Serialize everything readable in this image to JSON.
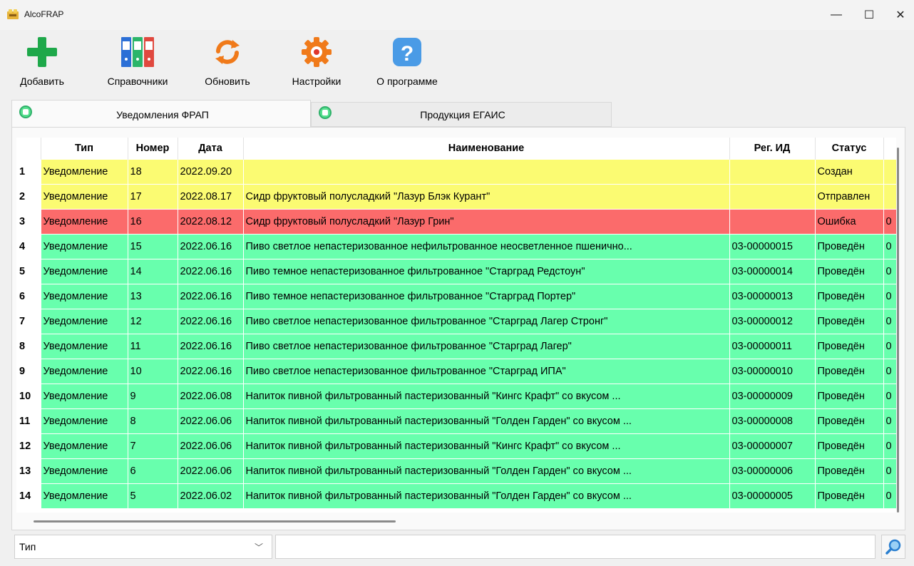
{
  "window": {
    "title": "AlcoFRAP",
    "minimize": "—",
    "maximize": "☐",
    "close": "✕"
  },
  "toolbar": {
    "add_label": "Добавить",
    "refs_label": "Справочники",
    "refresh_label": "Обновить",
    "settings_label": "Настройки",
    "about_label": "О программе"
  },
  "tabs": [
    {
      "label": "Уведомления ФРАП",
      "active": true
    },
    {
      "label": "Продукция ЕГАИС",
      "active": false
    }
  ],
  "table": {
    "columns": [
      "Тип",
      "Номер",
      "Дата",
      "Наименование",
      "Рег. ИД",
      "Статус"
    ],
    "rows": [
      {
        "n": "1",
        "type": "Уведомление",
        "num": "18",
        "date": "2022.09.20",
        "name": "",
        "reg": "",
        "status": "Создан",
        "extra": "",
        "state": "created"
      },
      {
        "n": "2",
        "type": "Уведомление",
        "num": "17",
        "date": "2022.08.17",
        "name": "Сидр фруктовый полусладкий \"Лазур Блэк Курант\"",
        "reg": "",
        "status": "Отправлен",
        "extra": "",
        "state": "sent"
      },
      {
        "n": "3",
        "type": "Уведомление",
        "num": "16",
        "date": "2022.08.12",
        "name": "Сидр фруктовый полусладкий \"Лазур Грин\"",
        "reg": "",
        "status": "Ошибка",
        "extra": "0",
        "state": "error"
      },
      {
        "n": "4",
        "type": "Уведомление",
        "num": "15",
        "date": "2022.06.16",
        "name": "Пиво светлое непастеризованное нефильтрованное неосветленное пшенично...",
        "reg": "03-00000015",
        "status": "Проведён",
        "extra": "0",
        "state": "done"
      },
      {
        "n": "5",
        "type": "Уведомление",
        "num": "14",
        "date": "2022.06.16",
        "name": "Пиво темное непастеризованное фильтрованное \"Старград Редстоун\"",
        "reg": "03-00000014",
        "status": "Проведён",
        "extra": "0",
        "state": "done"
      },
      {
        "n": "6",
        "type": "Уведомление",
        "num": "13",
        "date": "2022.06.16",
        "name": "Пиво темное непастеризованное фильтрованное \"Старград Портер\"",
        "reg": "03-00000013",
        "status": "Проведён",
        "extra": "0",
        "state": "done"
      },
      {
        "n": "7",
        "type": "Уведомление",
        "num": "12",
        "date": "2022.06.16",
        "name": "Пиво светлое непастеризованное фильтрованное \"Старград Лагер Стронг\"",
        "reg": "03-00000012",
        "status": "Проведён",
        "extra": "0",
        "state": "done"
      },
      {
        "n": "8",
        "type": "Уведомление",
        "num": "11",
        "date": "2022.06.16",
        "name": "Пиво светлое непастеризованное фильтрованное \"Старград Лагер\"",
        "reg": "03-00000011",
        "status": "Проведён",
        "extra": "0",
        "state": "done"
      },
      {
        "n": "9",
        "type": "Уведомление",
        "num": "10",
        "date": "2022.06.16",
        "name": "Пиво светлое непастеризованное фильтрованное \"Старград ИПА\"",
        "reg": "03-00000010",
        "status": "Проведён",
        "extra": "0",
        "state": "done"
      },
      {
        "n": "10",
        "type": "Уведомление",
        "num": "9",
        "date": "2022.06.08",
        "name": "Напиток пивной фильтрованный пастеризованный \"Кингс Крафт\" со вкусом ...",
        "reg": "03-00000009",
        "status": "Проведён",
        "extra": "0",
        "state": "done"
      },
      {
        "n": "11",
        "type": "Уведомление",
        "num": "8",
        "date": "2022.06.06",
        "name": "Напиток пивной фильтрованный пастеризованный \"Голден Гарден\" со вкусом ...",
        "reg": "03-00000008",
        "status": "Проведён",
        "extra": "0",
        "state": "done"
      },
      {
        "n": "12",
        "type": "Уведомление",
        "num": "7",
        "date": "2022.06.06",
        "name": "Напиток пивной фильтрованный пастеризованный \"Кингс Крафт\" со вкусом ...",
        "reg": "03-00000007",
        "status": "Проведён",
        "extra": "0",
        "state": "done"
      },
      {
        "n": "13",
        "type": "Уведомление",
        "num": "6",
        "date": "2022.06.06",
        "name": "Напиток пивной фильтрованный пастеризованный \"Голден Гарден\" со вкусом ...",
        "reg": "03-00000006",
        "status": "Проведён",
        "extra": "0",
        "state": "done"
      },
      {
        "n": "14",
        "type": "Уведомление",
        "num": "5",
        "date": "2022.06.02",
        "name": "Напиток пивной фильтрованный пастеризованный \"Голден Гарден\" со вкусом ...",
        "reg": "03-00000005",
        "status": "Проведён",
        "extra": "0",
        "state": "done"
      }
    ]
  },
  "filter": {
    "field_selected": "Тип",
    "search_value": ""
  },
  "colors": {
    "created": "#fbfb72",
    "sent": "#fbfb72",
    "error": "#fb6b6b",
    "done": "#68ffad"
  },
  "icons": {
    "add": "plus-icon",
    "refs": "binders-icon",
    "refresh": "refresh-icon",
    "settings": "gear-icon",
    "about": "question-icon",
    "search": "magnifier-icon"
  }
}
